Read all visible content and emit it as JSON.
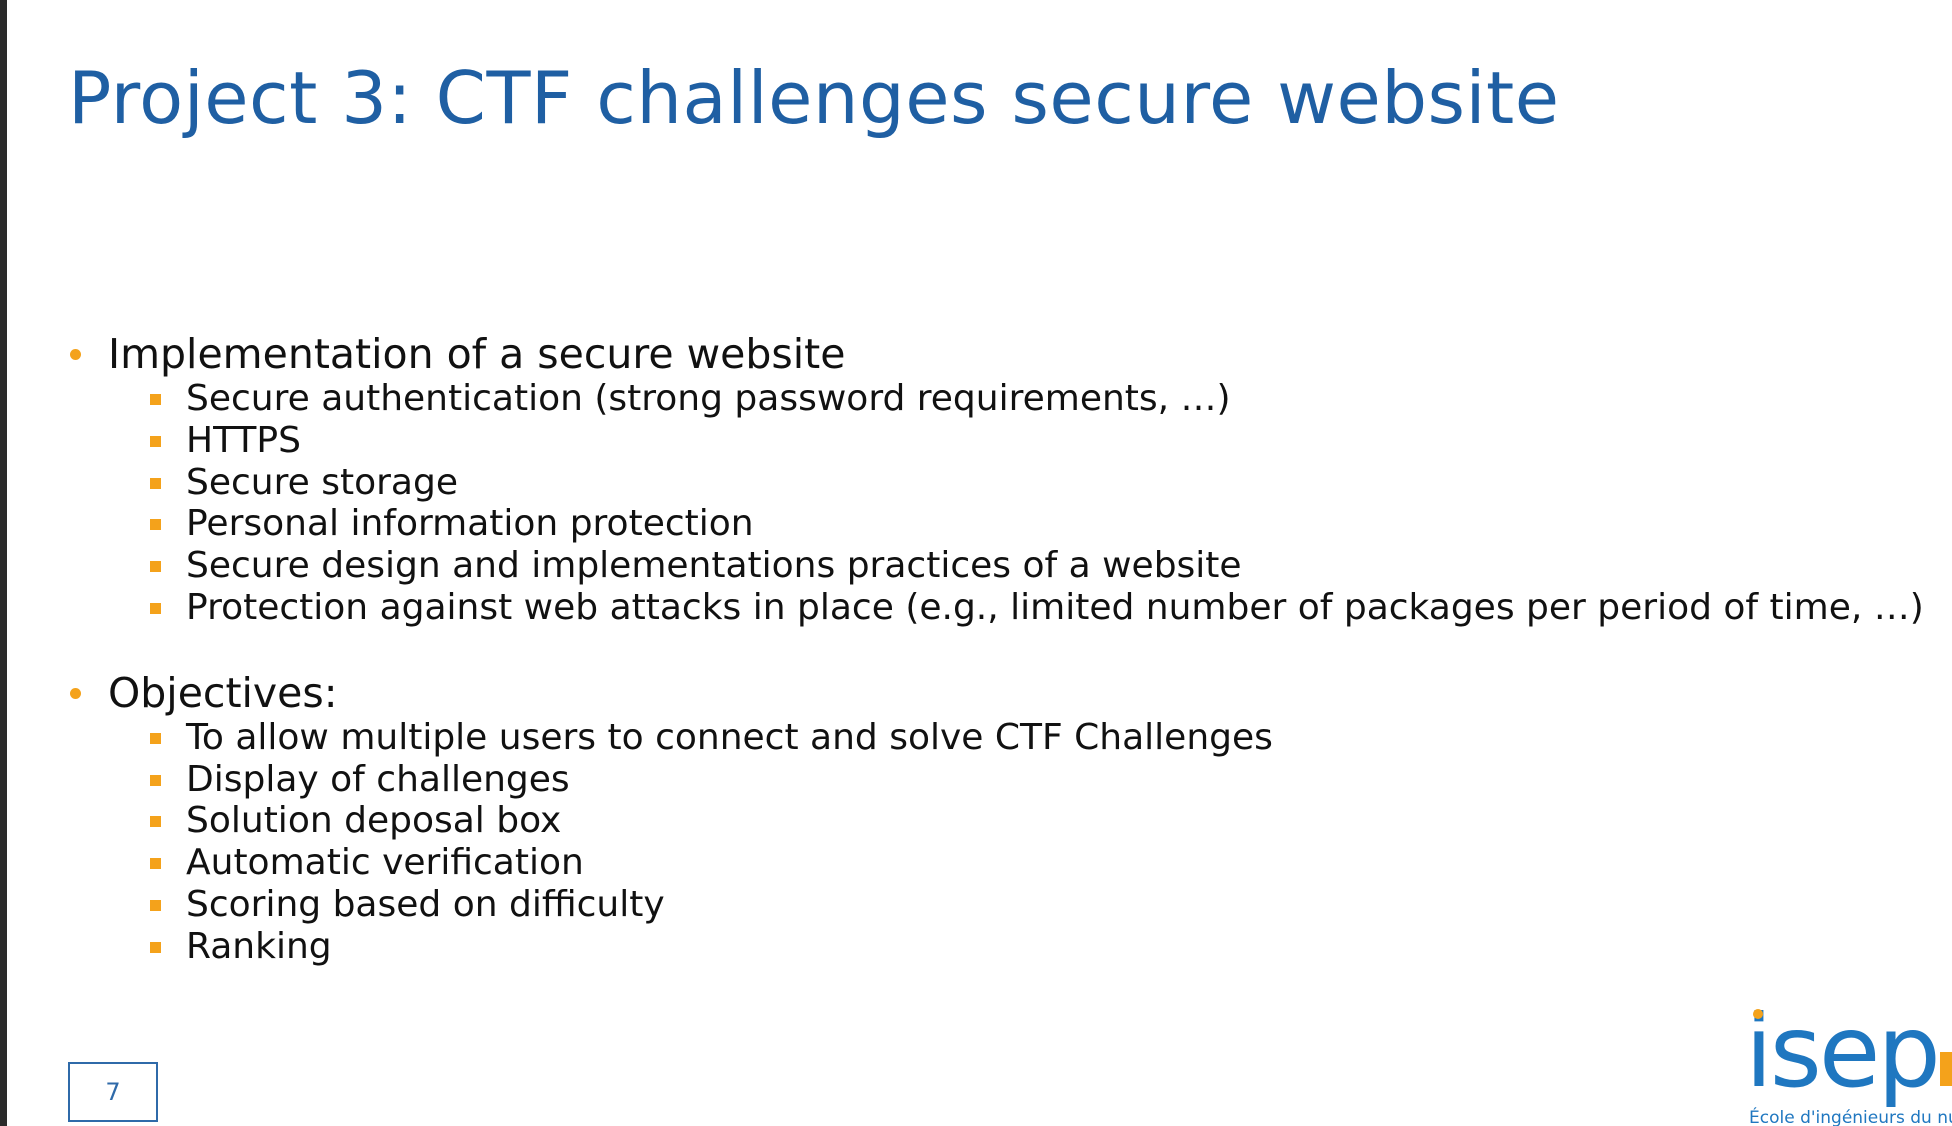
{
  "slide": {
    "title": "Project 3: CTF challenges secure website",
    "page_number": "7",
    "colors": {
      "title": "#1f5fa3",
      "bullet_accent": "#f4a21b",
      "text": "#111111",
      "logo": "#1f77c0"
    }
  },
  "sections": [
    {
      "heading": "Implementation of a secure website",
      "items": [
        "Secure authentication (strong password requirements, …)",
        "HTTPS",
        "Secure storage",
        "Personal information protection",
        "Secure design and implementations practices of a website",
        "Protection against web attacks in place (e.g., limited number of packages per period of time, …)"
      ]
    },
    {
      "heading": "Objectives:",
      "items": [
        "To allow multiple users to connect and solve CTF Challenges",
        "Display of challenges",
        "Solution deposal box",
        "Automatic verification",
        "Scoring based on difficulty",
        "Ranking"
      ]
    }
  ],
  "logo": {
    "word": "isep",
    "tagline": "École d'ingénieurs du nu"
  }
}
